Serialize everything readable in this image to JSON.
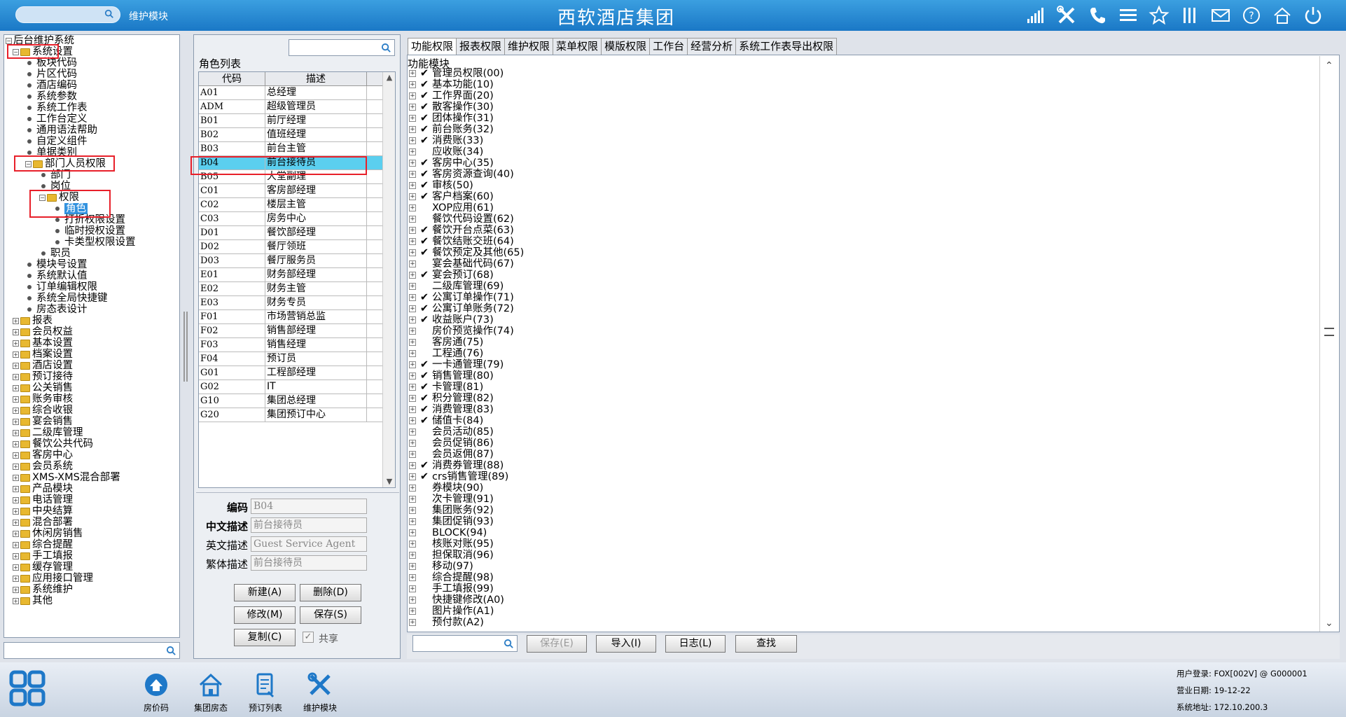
{
  "header": {
    "search_placeholder": "",
    "module_label": "维护模块",
    "app_title": "西软酒店集团",
    "icons": [
      "signal-icon",
      "tools-icon",
      "phone-icon",
      "menu-icon",
      "star-icon",
      "columns-icon",
      "mail-icon",
      "help-icon",
      "home-icon",
      "power-icon"
    ]
  },
  "tree": {
    "items": [
      {
        "label": "后台维护系统",
        "level": 0,
        "kind": "root"
      },
      {
        "label": "系统设置",
        "level": 1,
        "kind": "folder",
        "open": true
      },
      {
        "label": "板块代码",
        "level": 2,
        "kind": "leaf"
      },
      {
        "label": "片区代码",
        "level": 2,
        "kind": "leaf"
      },
      {
        "label": "酒店编码",
        "level": 2,
        "kind": "leaf"
      },
      {
        "label": "系统参数",
        "level": 2,
        "kind": "leaf"
      },
      {
        "label": "系统工作表",
        "level": 2,
        "kind": "leaf"
      },
      {
        "label": "工作台定义",
        "level": 2,
        "kind": "leaf"
      },
      {
        "label": "通用语法帮助",
        "level": 2,
        "kind": "leaf"
      },
      {
        "label": "自定义组件",
        "level": 2,
        "kind": "leaf"
      },
      {
        "label": "单据类别",
        "level": 2,
        "kind": "leaf"
      },
      {
        "label": "部门人员权限",
        "level": 2,
        "kind": "folder",
        "open": true
      },
      {
        "label": "部门",
        "level": 3,
        "kind": "leaf"
      },
      {
        "label": "岗位",
        "level": 3,
        "kind": "leaf"
      },
      {
        "label": "权限",
        "level": 3,
        "kind": "folder",
        "open": true
      },
      {
        "label": "角色",
        "level": 4,
        "kind": "leaf",
        "selected": true
      },
      {
        "label": "打折权限设置",
        "level": 4,
        "kind": "leaf"
      },
      {
        "label": "临时授权设置",
        "level": 4,
        "kind": "leaf"
      },
      {
        "label": "卡类型权限设置",
        "level": 4,
        "kind": "leaf"
      },
      {
        "label": "职员",
        "level": 3,
        "kind": "leaf"
      },
      {
        "label": "模块号设置",
        "level": 2,
        "kind": "leaf"
      },
      {
        "label": "系统默认值",
        "level": 2,
        "kind": "leaf"
      },
      {
        "label": "订单编辑权限",
        "level": 2,
        "kind": "leaf"
      },
      {
        "label": "系统全局快捷键",
        "level": 2,
        "kind": "leaf"
      },
      {
        "label": "房态表设计",
        "level": 2,
        "kind": "leaf"
      },
      {
        "label": "报表",
        "level": 1,
        "kind": "folder"
      },
      {
        "label": "会员权益",
        "level": 1,
        "kind": "folder"
      },
      {
        "label": "基本设置",
        "level": 1,
        "kind": "folder"
      },
      {
        "label": "档案设置",
        "level": 1,
        "kind": "folder"
      },
      {
        "label": "酒店设置",
        "level": 1,
        "kind": "folder"
      },
      {
        "label": "预订接待",
        "level": 1,
        "kind": "folder"
      },
      {
        "label": "公关销售",
        "level": 1,
        "kind": "folder"
      },
      {
        "label": "账务审核",
        "level": 1,
        "kind": "folder"
      },
      {
        "label": "综合收银",
        "level": 1,
        "kind": "folder"
      },
      {
        "label": "宴会销售",
        "level": 1,
        "kind": "folder"
      },
      {
        "label": "二级库管理",
        "level": 1,
        "kind": "folder"
      },
      {
        "label": "餐饮公共代码",
        "level": 1,
        "kind": "folder"
      },
      {
        "label": "客房中心",
        "level": 1,
        "kind": "folder"
      },
      {
        "label": "会员系统",
        "level": 1,
        "kind": "folder"
      },
      {
        "label": "XMS-XMS混合部署",
        "level": 1,
        "kind": "folder"
      },
      {
        "label": "产品模块",
        "level": 1,
        "kind": "folder"
      },
      {
        "label": "电话管理",
        "level": 1,
        "kind": "folder"
      },
      {
        "label": "中央结算",
        "level": 1,
        "kind": "folder"
      },
      {
        "label": "混合部署",
        "level": 1,
        "kind": "folder"
      },
      {
        "label": "休闲房销售",
        "level": 1,
        "kind": "folder"
      },
      {
        "label": "综合提醒",
        "level": 1,
        "kind": "folder"
      },
      {
        "label": "手工填报",
        "level": 1,
        "kind": "folder"
      },
      {
        "label": "缓存管理",
        "level": 1,
        "kind": "folder"
      },
      {
        "label": "应用接口管理",
        "level": 1,
        "kind": "folder"
      },
      {
        "label": "系统维护",
        "level": 1,
        "kind": "folder"
      },
      {
        "label": "其他",
        "level": 1,
        "kind": "folder"
      }
    ]
  },
  "roles": {
    "list_title": "角色列表",
    "col_code": "代码",
    "col_desc": "描述",
    "rows": [
      {
        "code": "A01",
        "desc": "总经理"
      },
      {
        "code": "ADM",
        "desc": "超级管理员"
      },
      {
        "code": "B01",
        "desc": "前厅经理"
      },
      {
        "code": "B02",
        "desc": "值班经理"
      },
      {
        "code": "B03",
        "desc": "前台主管"
      },
      {
        "code": "B04",
        "desc": "前台接待员",
        "selected": true
      },
      {
        "code": "B05",
        "desc": "大堂副理"
      },
      {
        "code": "C01",
        "desc": "客房部经理"
      },
      {
        "code": "C02",
        "desc": "楼层主管"
      },
      {
        "code": "C03",
        "desc": "房务中心"
      },
      {
        "code": "D01",
        "desc": "餐饮部经理"
      },
      {
        "code": "D02",
        "desc": "餐厅领班"
      },
      {
        "code": "D03",
        "desc": "餐厅服务员"
      },
      {
        "code": "E01",
        "desc": "财务部经理"
      },
      {
        "code": "E02",
        "desc": "财务主管"
      },
      {
        "code": "E03",
        "desc": "财务专员"
      },
      {
        "code": "F01",
        "desc": "市场营销总监"
      },
      {
        "code": "F02",
        "desc": "销售部经理"
      },
      {
        "code": "F03",
        "desc": "销售经理"
      },
      {
        "code": "F04",
        "desc": "预订员"
      },
      {
        "code": "G01",
        "desc": "工程部经理"
      },
      {
        "code": "G02",
        "desc": "IT"
      },
      {
        "code": "G10",
        "desc": "集团总经理"
      },
      {
        "code": "G20",
        "desc": "集团预订中心"
      }
    ]
  },
  "form": {
    "code_label": "编码",
    "code_value": "B04",
    "cn_label": "中文描述",
    "cn_value": "前台接待员",
    "en_label": "英文描述",
    "en_value": "Guest Service Agent",
    "tw_label": "繁体描述",
    "tw_value": "前台接待员",
    "new_button": "新建(A)",
    "delete_button": "删除(D)",
    "edit_button": "修改(M)",
    "save_button": "保存(S)",
    "copy_button": "复制(C)",
    "share_label": "共享",
    "share_checked": true
  },
  "tabs": [
    "功能权限",
    "报表权限",
    "维护权限",
    "菜单权限",
    "模版权限",
    "工作台",
    "经营分析",
    "系统工作表导出权限"
  ],
  "permissions": {
    "title": "功能模块",
    "items": [
      {
        "label": "管理员权限(00)",
        "checked": true
      },
      {
        "label": "基本功能(10)",
        "checked": true
      },
      {
        "label": "工作界面(20)",
        "checked": true
      },
      {
        "label": "散客操作(30)",
        "checked": true
      },
      {
        "label": "团体操作(31)",
        "checked": true
      },
      {
        "label": "前台账务(32)",
        "checked": true
      },
      {
        "label": "消费账(33)",
        "checked": true
      },
      {
        "label": "应收账(34)",
        "checked": false
      },
      {
        "label": "客房中心(35)",
        "checked": true
      },
      {
        "label": "客房资源查询(40)",
        "checked": true
      },
      {
        "label": "审核(50)",
        "checked": true
      },
      {
        "label": "客户档案(60)",
        "checked": true
      },
      {
        "label": "XOP应用(61)",
        "checked": false
      },
      {
        "label": "餐饮代码设置(62)",
        "checked": false
      },
      {
        "label": "餐饮开台点菜(63)",
        "checked": true
      },
      {
        "label": "餐饮结账交班(64)",
        "checked": true
      },
      {
        "label": "餐饮预定及其他(65)",
        "checked": true
      },
      {
        "label": "宴会基础代码(67)",
        "checked": false
      },
      {
        "label": "宴会预订(68)",
        "checked": true
      },
      {
        "label": "二级库管理(69)",
        "checked": false
      },
      {
        "label": "公寓订单操作(71)",
        "checked": true
      },
      {
        "label": "公寓订单账务(72)",
        "checked": true
      },
      {
        "label": "收益账户(73)",
        "checked": true
      },
      {
        "label": "房价预览操作(74)",
        "checked": false
      },
      {
        "label": "客房通(75)",
        "checked": false
      },
      {
        "label": "工程通(76)",
        "checked": false
      },
      {
        "label": "一卡通管理(79)",
        "checked": true
      },
      {
        "label": "销售管理(80)",
        "checked": true
      },
      {
        "label": "卡管理(81)",
        "checked": true
      },
      {
        "label": "积分管理(82)",
        "checked": true
      },
      {
        "label": "消费管理(83)",
        "checked": true
      },
      {
        "label": "储值卡(84)",
        "checked": true
      },
      {
        "label": "会员活动(85)",
        "checked": false
      },
      {
        "label": "会员促销(86)",
        "checked": false
      },
      {
        "label": "会员返佣(87)",
        "checked": false
      },
      {
        "label": "消费券管理(88)",
        "checked": true
      },
      {
        "label": "crs销售管理(89)",
        "checked": true
      },
      {
        "label": "券模块(90)",
        "checked": false
      },
      {
        "label": "次卡管理(91)",
        "checked": false
      },
      {
        "label": "集团账务(92)",
        "checked": false
      },
      {
        "label": "集团促销(93)",
        "checked": false
      },
      {
        "label": "BLOCK(94)",
        "checked": false
      },
      {
        "label": "核账对账(95)",
        "checked": false
      },
      {
        "label": "担保取消(96)",
        "checked": false
      },
      {
        "label": "移动(97)",
        "checked": false
      },
      {
        "label": "综合提醒(98)",
        "checked": false
      },
      {
        "label": "手工填报(99)",
        "checked": false
      },
      {
        "label": "快捷键修改(A0)",
        "checked": false
      },
      {
        "label": "图片操作(A1)",
        "checked": false
      },
      {
        "label": "预付款(A2)",
        "checked": false
      }
    ]
  },
  "bottom_toolbar": {
    "save_button": "保存(E)",
    "import_button": "导入(I)",
    "log_button": "日志(L)",
    "find_button": "查找"
  },
  "footer": {
    "items": [
      {
        "label": "房价码",
        "icon": "price-tag-icon"
      },
      {
        "label": "集团房态",
        "icon": "house-icon"
      },
      {
        "label": "预订列表",
        "icon": "booking-list-icon"
      },
      {
        "label": "维护模块",
        "icon": "tools-icon"
      }
    ],
    "user_login": "用户登录: FOX[002V] @ G000001",
    "business_date": "营业日期: 19-12-22",
    "system_address": "系统地址: 172.10.200.3"
  }
}
